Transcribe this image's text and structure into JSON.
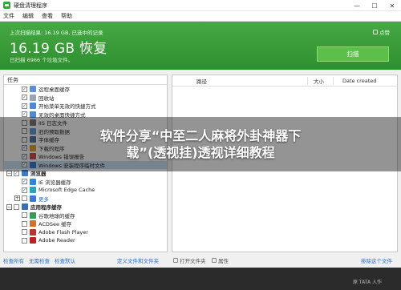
{
  "window": {
    "title": "硬盘清理程序",
    "minimize": "—",
    "maximize": "☐",
    "close": "✕"
  },
  "menu": [
    "文件",
    "编辑",
    "查看",
    "帮助"
  ],
  "banner": {
    "status": "上次扫描结果: 16.19 GB, 已选中的记录",
    "size": "16.19 GB 恢复",
    "sub": "已扫描 6966 个垃圾文件。",
    "like": "点赞",
    "scan_button": "扫描"
  },
  "tasks": {
    "header": "任务",
    "rows": [
      {
        "label": "远程桌面缓存",
        "checked": true,
        "level": 1,
        "icon_color": "#5b8fd6",
        "icon": "remote-desktop-icon"
      },
      {
        "label": "回收站",
        "checked": true,
        "level": 1,
        "icon_color": "#9aa4ae",
        "icon": "recycle-bin-icon"
      },
      {
        "label": "开始菜单无效的快捷方式",
        "checked": true,
        "level": 1,
        "icon_color": "#4a8ad8",
        "icon": "start-menu-icon"
      },
      {
        "label": "无效的桌面快捷方式",
        "checked": true,
        "level": 1,
        "icon_color": "#4a8ad8",
        "icon": "shortcut-icon"
      },
      {
        "label": "IIS 日志文件",
        "checked": false,
        "level": 1,
        "icon_color": "#7a7a7a",
        "icon": "log-file-icon"
      },
      {
        "label": "旧的预取数据",
        "checked": false,
        "level": 1,
        "icon_color": "#6a9bd8",
        "icon": "prefetch-icon"
      },
      {
        "label": "字体缓存",
        "checked": false,
        "level": 1,
        "icon_color": "#5577aa",
        "icon": "font-icon"
      },
      {
        "label": "下载的程序",
        "checked": true,
        "level": 1,
        "icon_color": "#e0a030",
        "icon": "download-icon"
      },
      {
        "label": "Windows 错误报告",
        "checked": true,
        "level": 1,
        "icon_color": "#d05050",
        "icon": "error-report-icon"
      },
      {
        "label": "Windows 安装程序临时文件",
        "checked": true,
        "level": 1,
        "icon_color": "#3f7fcf",
        "icon": "windows-icon",
        "selected": true
      },
      {
        "label": "浏览器",
        "checked": true,
        "level": 0,
        "bold": true,
        "expander": "−",
        "icon_color": "#3a7ad0",
        "icon": "browser-icon"
      },
      {
        "label": "IE 浏览器缓存",
        "checked": true,
        "level": 1,
        "icon_color": "#2f86d9",
        "icon": "ie-icon"
      },
      {
        "label": "Microsoft Edge Cache",
        "checked": true,
        "level": 1,
        "icon_color": "#2aa2b8",
        "icon": "edge-icon"
      },
      {
        "label": "更多",
        "checked": false,
        "level": 1,
        "link": true,
        "icon_color": "#3a7ad0",
        "icon": "more-icon",
        "expander": "+"
      },
      {
        "label": "应用程序缓存",
        "checked": false,
        "level": 0,
        "bold": true,
        "expander": "−",
        "icon_color": "#3b6fb5",
        "icon": "app-cache-icon"
      },
      {
        "label": "谷歌地球的缓存",
        "checked": false,
        "level": 1,
        "icon_color": "#3a9a5a",
        "icon": "google-earth-icon"
      },
      {
        "label": "ACDSee 缓存",
        "checked": false,
        "level": 1,
        "icon_color": "#d07030",
        "icon": "acdsee-icon"
      },
      {
        "label": "Adobe Flash Player",
        "checked": false,
        "level": 1,
        "icon_color": "#c03030",
        "icon": "flash-icon"
      },
      {
        "label": "Adobe Reader",
        "checked": false,
        "level": 1,
        "icon_color": "#c02020",
        "icon": "adobe-reader-icon"
      }
    ]
  },
  "results": {
    "columns": {
      "path": "路径",
      "size": "大小",
      "date": "Date created"
    }
  },
  "status": {
    "check_all": "检查所有",
    "check_none": "无需检查",
    "check_default": "检查默认",
    "goto": "定义文件和文件夹",
    "open_folder": "打开文件夹",
    "properties": "属性",
    "unlock": "排除这个文件"
  },
  "overlay": {
    "line1": "软件分享“中至二人麻将外卦神器下",
    "line2": "载”(透视挂)透视详细教程"
  },
  "watermark": "原 TATA 入作"
}
